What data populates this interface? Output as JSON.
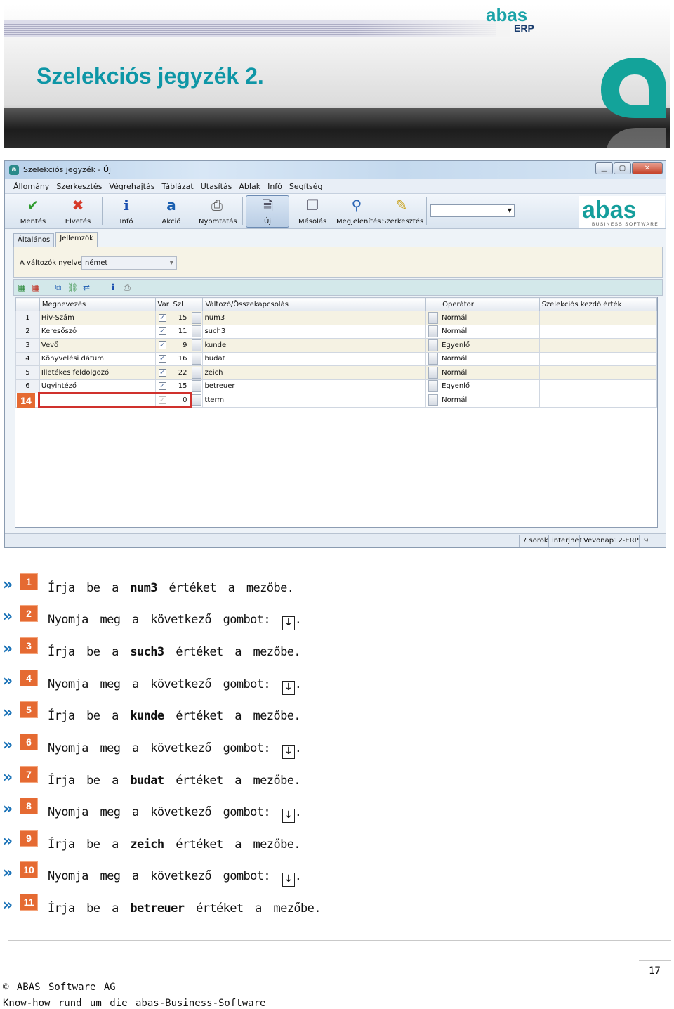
{
  "header": {
    "title": "Szelekciós jegyzék 2.",
    "logo_text": "abas",
    "logo_sub": "ERP"
  },
  "window": {
    "title": "Szelekciós jegyzék - Új",
    "menu": [
      "Állomány",
      "Szerkesztés",
      "Végrehajtás",
      "Táblázat",
      "Utasítás",
      "Ablak",
      "Infó",
      "Segítség"
    ],
    "toolbar": {
      "save": "Mentés",
      "discard": "Elvetés",
      "info": "Infó",
      "action": "Akció",
      "print": "Nyomtatás",
      "new": "Új",
      "copy": "Másolás",
      "display": "Megjelenítés",
      "edit": "Szerkesztés"
    },
    "brand": {
      "logo": "abas",
      "tagline": "BUSINESS SOFTWARE"
    },
    "tabs": [
      "Általános",
      "Jellemzők"
    ],
    "variables_language_label": "A változók nyelve",
    "variables_language_value": "német",
    "grid_icons": [
      "table-add-icon",
      "table-delete-icon",
      "copy-icon",
      "link-icon",
      "arrange-icon",
      "info-icon",
      "print-icon"
    ],
    "columns": [
      "Megnevezés",
      "Var",
      "Szl",
      "Változó/Összekapcsolás",
      "Operátor",
      "Szelekciós kezdő érték"
    ],
    "rows": [
      {
        "n": "1",
        "name": "Hiv-Szám",
        "var": "✓",
        "szl": "15",
        "variable": "num3",
        "operator": "Normál",
        "start": ""
      },
      {
        "n": "2",
        "name": "Keresőszó",
        "var": "✓",
        "szl": "11",
        "variable": "such3",
        "operator": "Normál",
        "start": ""
      },
      {
        "n": "3",
        "name": "Vevő",
        "var": "✓",
        "szl": "9",
        "variable": "kunde",
        "operator": "Egyenlő",
        "start": ""
      },
      {
        "n": "4",
        "name": "Könyvelési dátum",
        "var": "✓",
        "szl": "16",
        "variable": "budat",
        "operator": "Normál",
        "start": ""
      },
      {
        "n": "5",
        "name": "Illetékes feldolgozó",
        "var": "✓",
        "szl": "22",
        "variable": "zeich",
        "operator": "Normál",
        "start": ""
      },
      {
        "n": "6",
        "name": "Ügyintéző",
        "var": "✓",
        "szl": "15",
        "variable": "betreuer",
        "operator": "Egyenlő",
        "start": ""
      },
      {
        "n": "14",
        "name": "",
        "var": "✓",
        "szl": "0",
        "variable": "tterm",
        "operator": "Normál",
        "start": ""
      }
    ],
    "status": {
      "rows": "7 sorok",
      "user": "interjnet",
      "server": "Vevonap12-ERP",
      "num": "9"
    }
  },
  "steps": [
    {
      "n": "1",
      "pre": "Írja be a",
      "bold": "num3",
      "post": "értéket a mezőbe."
    },
    {
      "n": "2",
      "pre": "Nyomja meg a következő gombot:",
      "bold": "",
      "post": "."
    },
    {
      "n": "3",
      "pre": "Írja be a",
      "bold": "such3",
      "post": "értéket a mezőbe."
    },
    {
      "n": "4",
      "pre": "Nyomja meg a következő gombot:",
      "bold": "",
      "post": "."
    },
    {
      "n": "5",
      "pre": "Írja be a",
      "bold": "kunde",
      "post": "értéket a mezőbe."
    },
    {
      "n": "6",
      "pre": "Nyomja meg a következő gombot:",
      "bold": "",
      "post": "."
    },
    {
      "n": "7",
      "pre": "Írja be a",
      "bold": "budat",
      "post": "értéket a mezőbe."
    },
    {
      "n": "8",
      "pre": "Nyomja meg a következő gombot:",
      "bold": "",
      "post": "."
    },
    {
      "n": "9",
      "pre": "Írja be a",
      "bold": "zeich",
      "post": "értéket a mezőbe."
    },
    {
      "n": "10",
      "pre": "Nyomja meg a következő gombot:",
      "bold": "",
      "post": "."
    },
    {
      "n": "11",
      "pre": "Írja be a",
      "bold": "betreuer",
      "post": "értéket a mezőbe."
    }
  ],
  "footer": {
    "page": "17",
    "copyright": "© ABAS Software AG",
    "tagline": "Know-how rund um die abas-Business-Software"
  },
  "colors": {
    "accent": "#0e96a6",
    "badge": "#e56a32",
    "chevron": "#1b73b8",
    "highlight": "#d0312d"
  }
}
